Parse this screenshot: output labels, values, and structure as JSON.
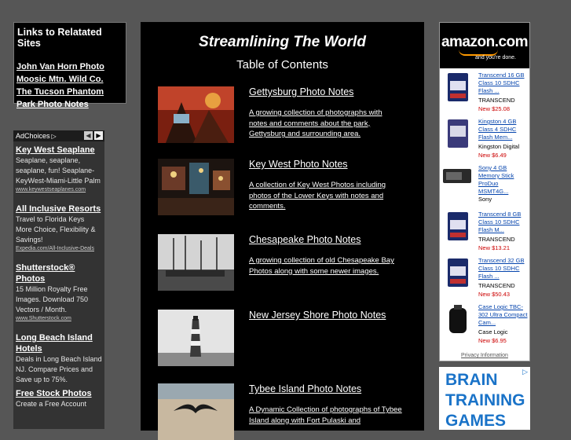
{
  "links": {
    "title": "Links to Relatated Sites",
    "items": [
      "John Van Horn Photo",
      "Moosic Mtn. Wild Co.",
      "The Tucson Phantom",
      "Park Photo Notes"
    ]
  },
  "ads": {
    "header": "AdChoices",
    "items": [
      {
        "title": "Key West Seaplane",
        "desc": "Seaplane, seaplane, seaplane, fun! Seaplane-KeyWest-Miami-Little Palm",
        "url": "www.keywestseaplanes.com"
      },
      {
        "title": "All Inclusive Resorts",
        "desc": "Travel to Florida Keys More Choice, Flexibility & Savings!",
        "url": "Expedia.com/All-Inclusive-Deals"
      },
      {
        "title": "Shutterstock® Photos",
        "desc": "15 Million Royalty Free Images. Download 750 Vectors / Month.",
        "url": "www.Shutterstock.com"
      },
      {
        "title": "Long Beach Island Hotels",
        "desc": "Deals in Long Beach Island NJ. Compare Prices and Save up to 75%.",
        "url": ""
      },
      {
        "title": "Free Stock Photos",
        "desc": "Create a Free Account",
        "url": ""
      }
    ]
  },
  "main": {
    "site_title": "Streamlining The World",
    "toc_label": "Table of Contents",
    "entries": [
      {
        "title": "Gettysburg Photo Notes",
        "desc": "A growing collection of photographs with notes and comments about the park, Gettysburg and surrounding area."
      },
      {
        "title": "Key West Photo Notes",
        "desc": "A collection of Key West Photos including photos of the Lower Keys with notes and comments."
      },
      {
        "title": "Chesapeake Photo Notes",
        "desc": "A growing collection of old Chesapeake Bay Photos along with some newer images."
      },
      {
        "title": "New Jersey Shore Photo Notes",
        "desc": ""
      },
      {
        "title": "Tybee Island Photo Notes",
        "desc": "A Dynamic Collection of photographs of Tybee Island along with Fort Pulaski and"
      }
    ]
  },
  "amazon": {
    "logo": "amazon.com",
    "tagline": "and you're done.",
    "products": [
      {
        "title": "Transcend 16 GB Class 10 SDHC Flash ...",
        "maker": "TRANSCEND",
        "price": "New $25.08"
      },
      {
        "title": "Kingston 4 GB Class 4 SDHC Flash Mem...",
        "maker": "Kingston Digital",
        "price": "New $6.49"
      },
      {
        "title": "Sony 4 GB Memory Stick ProDuo MSMT4G...",
        "maker": "Sony",
        "price": ""
      },
      {
        "title": "Transcend 8 GB Class 10 SDHC Flash M...",
        "maker": "TRANSCEND",
        "price": "New $13.21"
      },
      {
        "title": "Transcend 32 GB Class 10 SDHC Flash ...",
        "maker": "TRANSCEND",
        "price": "New $50.43"
      },
      {
        "title": "Case Logic TBC-302 Ultra Compact Cam...",
        "maker": "Case Logic",
        "price": "New $6.95"
      }
    ],
    "privacy": "Privacy Information"
  },
  "brain_ad": {
    "lines": [
      "BRAIN",
      "TRAINING",
      "GAMES"
    ]
  }
}
